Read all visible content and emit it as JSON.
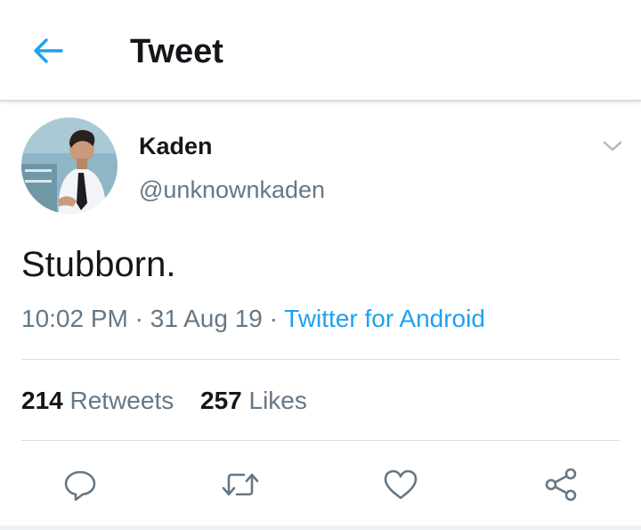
{
  "header": {
    "title": "Tweet",
    "back_icon": "arrow-left-icon",
    "accent_color": "#1da1f2"
  },
  "author": {
    "display_name": "Kaden",
    "handle": "@unknownkaden",
    "menu_icon": "chevron-down-icon"
  },
  "tweet": {
    "text": "Stubborn.",
    "time": "10:02 PM",
    "separator": "·",
    "date": "31 Aug 19",
    "source": "Twitter for Android"
  },
  "stats": {
    "retweets_count": "214",
    "retweets_label": "Retweets",
    "likes_count": "257",
    "likes_label": "Likes"
  },
  "actions": [
    {
      "icon": "reply-icon"
    },
    {
      "icon": "retweet-icon"
    },
    {
      "icon": "heart-icon"
    },
    {
      "icon": "share-icon"
    }
  ]
}
